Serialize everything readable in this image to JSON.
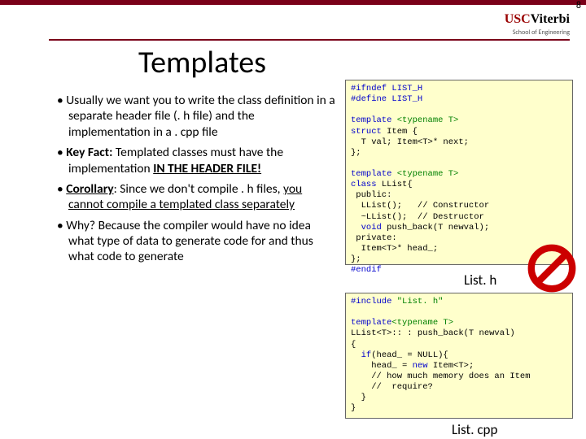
{
  "meta": {
    "page_number": "8",
    "logo_text_1": "USC",
    "logo_text_2": "Viterbi",
    "logo_sub": "School of Engineering"
  },
  "title": "Templates",
  "bullets": {
    "b1a": "Usually we want you to write the class definition in a separate header file (. h file) and the implementation in a . cpp file",
    "b2a": "Key Fact:",
    "b2b": "  Templated classes must have the implementation ",
    "b2c": "IN THE HEADER FILE!",
    "b3a": "Corollary",
    "b3b": ":  Since we don't compile . h files, ",
    "b3c": "you cannot compile a templated class separately",
    "b4a": "Why? Because the compiler would have no idea what type of data to generate code for and thus what code to generate"
  },
  "code1": {
    "l1": "#ifndef LIST_H",
    "l2": "#define LIST_H",
    "blank1": "",
    "l3a": "template ",
    "l3b": "<typename T>",
    "l4a": "struct",
    "l4b": " Item {",
    "l5a": "  T val; Item<T>* next;",
    "l6": "};",
    "blank2": "",
    "l7a": "template ",
    "l7b": "<typename T>",
    "l8a": "class",
    "l8b": " LList{",
    "l9": " public:",
    "l10": "  LList();   // Constructor",
    "l11": "  ~LList();  // Destructor",
    "l12a": "  ",
    "l12b": "void",
    "l12c": " push_back(T newval);",
    "l13": " private:",
    "l14": "  Item<T>* head_;",
    "l15": "};",
    "l16": "#endif"
  },
  "label1": "List. h",
  "code2": {
    "l1a": "#include ",
    "l1b": "\"List. h\"",
    "blank1": "",
    "l2a": "template",
    "l2b": "<typename T>",
    "l3": "LList<T>:: : push_back(T newval)",
    "l4": "{",
    "l5a": "  ",
    "l5b": "if",
    "l5c": "(head_ = NULL){",
    "l6a": "    head_ = ",
    "l6b": "new",
    "l6c": " Item<T>;",
    "l7": "    // how much memory does an Item",
    "l8": "    //  require?",
    "l9": "  }",
    "l10": "}"
  },
  "label2": "List. cpp"
}
